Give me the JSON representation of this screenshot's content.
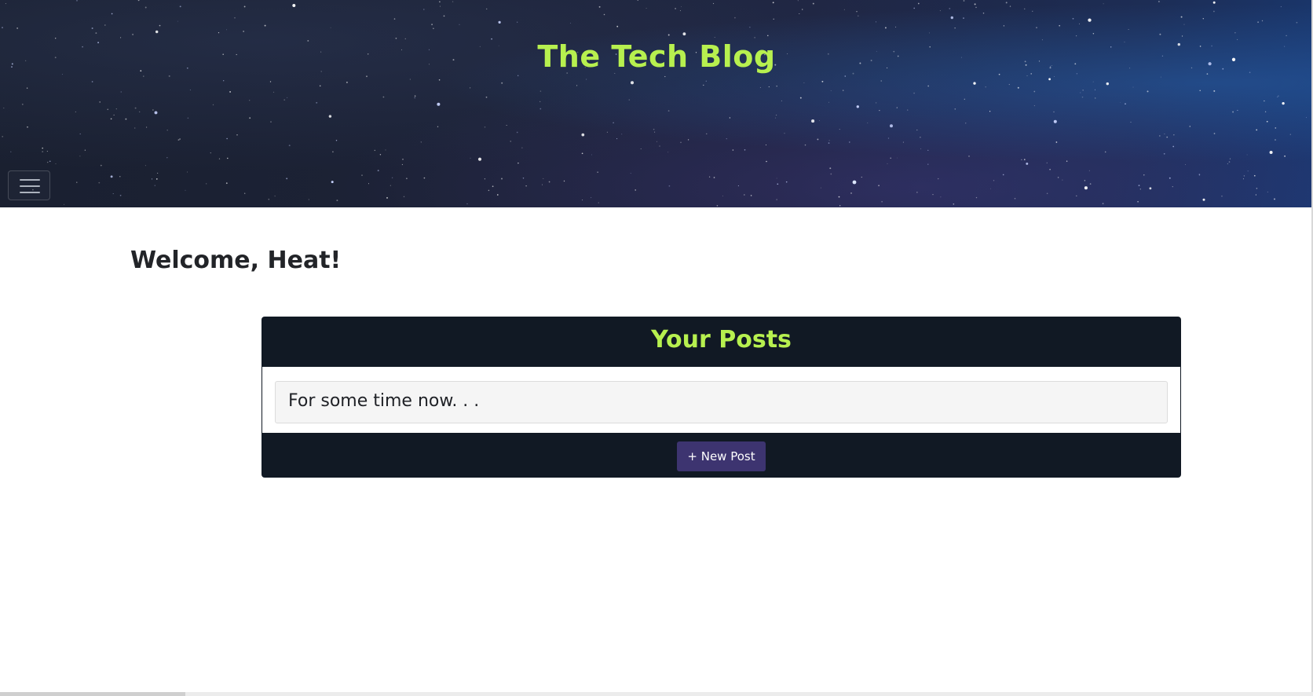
{
  "header": {
    "title": "The Tech Blog",
    "title_color": "#b7f04f",
    "background": "starry-night-sky",
    "menu_icon": "hamburger-menu-icon"
  },
  "main": {
    "welcome_text": "Welcome, Heat!",
    "posts_panel": {
      "heading": "Your Posts",
      "heading_color": "#b7f04f",
      "panel_color": "#111924",
      "posts": [
        {
          "title": "For some time now. . ."
        }
      ],
      "new_post_label": "+ New Post",
      "new_post_color": "#3d3470"
    }
  }
}
